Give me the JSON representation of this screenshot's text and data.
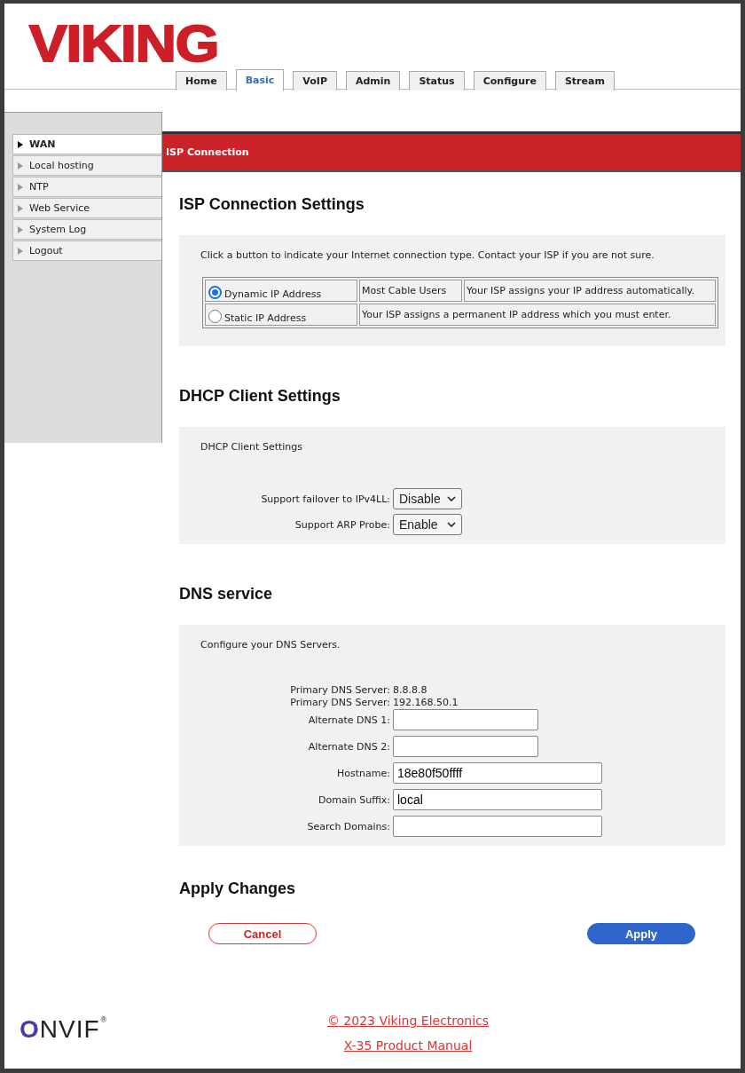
{
  "logo": "VIKING",
  "tabs": [
    {
      "label": "Home",
      "selected": false
    },
    {
      "label": "Basic",
      "selected": true
    },
    {
      "label": "VoIP",
      "selected": false
    },
    {
      "label": "Admin",
      "selected": false
    },
    {
      "label": "Status",
      "selected": false
    },
    {
      "label": "Configure",
      "selected": false
    },
    {
      "label": "Stream",
      "selected": false
    }
  ],
  "sidebar": {
    "items": [
      {
        "label": "WAN",
        "selected": true
      },
      {
        "label": "Local hosting",
        "selected": false
      },
      {
        "label": "NTP",
        "selected": false
      },
      {
        "label": "Web Service",
        "selected": false
      },
      {
        "label": "System Log",
        "selected": false
      },
      {
        "label": "Logout",
        "selected": false
      }
    ]
  },
  "banner": "ISP Connection",
  "isp": {
    "heading": "ISP Connection Settings",
    "intro": "Click a button to indicate your Internet connection type. Contact your ISP if you are not sure.",
    "options": [
      {
        "label": "Dynamic IP Address",
        "selected": true,
        "note": "Most Cable Users",
        "description": "Your ISP assigns your IP address automatically."
      },
      {
        "label": "Static IP Address",
        "selected": false,
        "description": "Your ISP assigns a permanent IP address which you must enter."
      }
    ]
  },
  "dhcp": {
    "heading": "DHCP Client Settings",
    "intro": "DHCP Client Settings",
    "selects": [
      {
        "label": "Support failover to IPv4LL:",
        "value": "Disable"
      },
      {
        "label": "Support ARP Probe:",
        "value": "Enable"
      }
    ]
  },
  "dns": {
    "heading": "DNS service",
    "intro": "Configure your DNS Servers.",
    "rows": [
      {
        "kind": "info",
        "label": "Primary DNS Server:",
        "value": "8.8.8.8"
      },
      {
        "kind": "info",
        "label": "Primary DNS Server:",
        "value": "192.168.50.1"
      },
      {
        "kind": "short",
        "label": "Alternate DNS 1:"
      },
      {
        "kind": "short",
        "label": "Alternate DNS 2:"
      },
      {
        "kind": "long",
        "label": "Hostname:",
        "value": "18e80f50ffff"
      },
      {
        "kind": "long",
        "label": "Domain Suffix:",
        "value": "local"
      },
      {
        "kind": "long",
        "label": "Search Domains:"
      }
    ]
  },
  "apply": {
    "heading": "Apply Changes",
    "buttons": [
      {
        "kind": "secondary",
        "label": "Cancel"
      },
      {
        "kind": "primary",
        "label": "Apply"
      }
    ]
  },
  "footer": {
    "logo": "ONVIF",
    "logo_mark": "®",
    "links": [
      "© 2023 Viking Electronics",
      "X-35 Product Manual"
    ]
  }
}
